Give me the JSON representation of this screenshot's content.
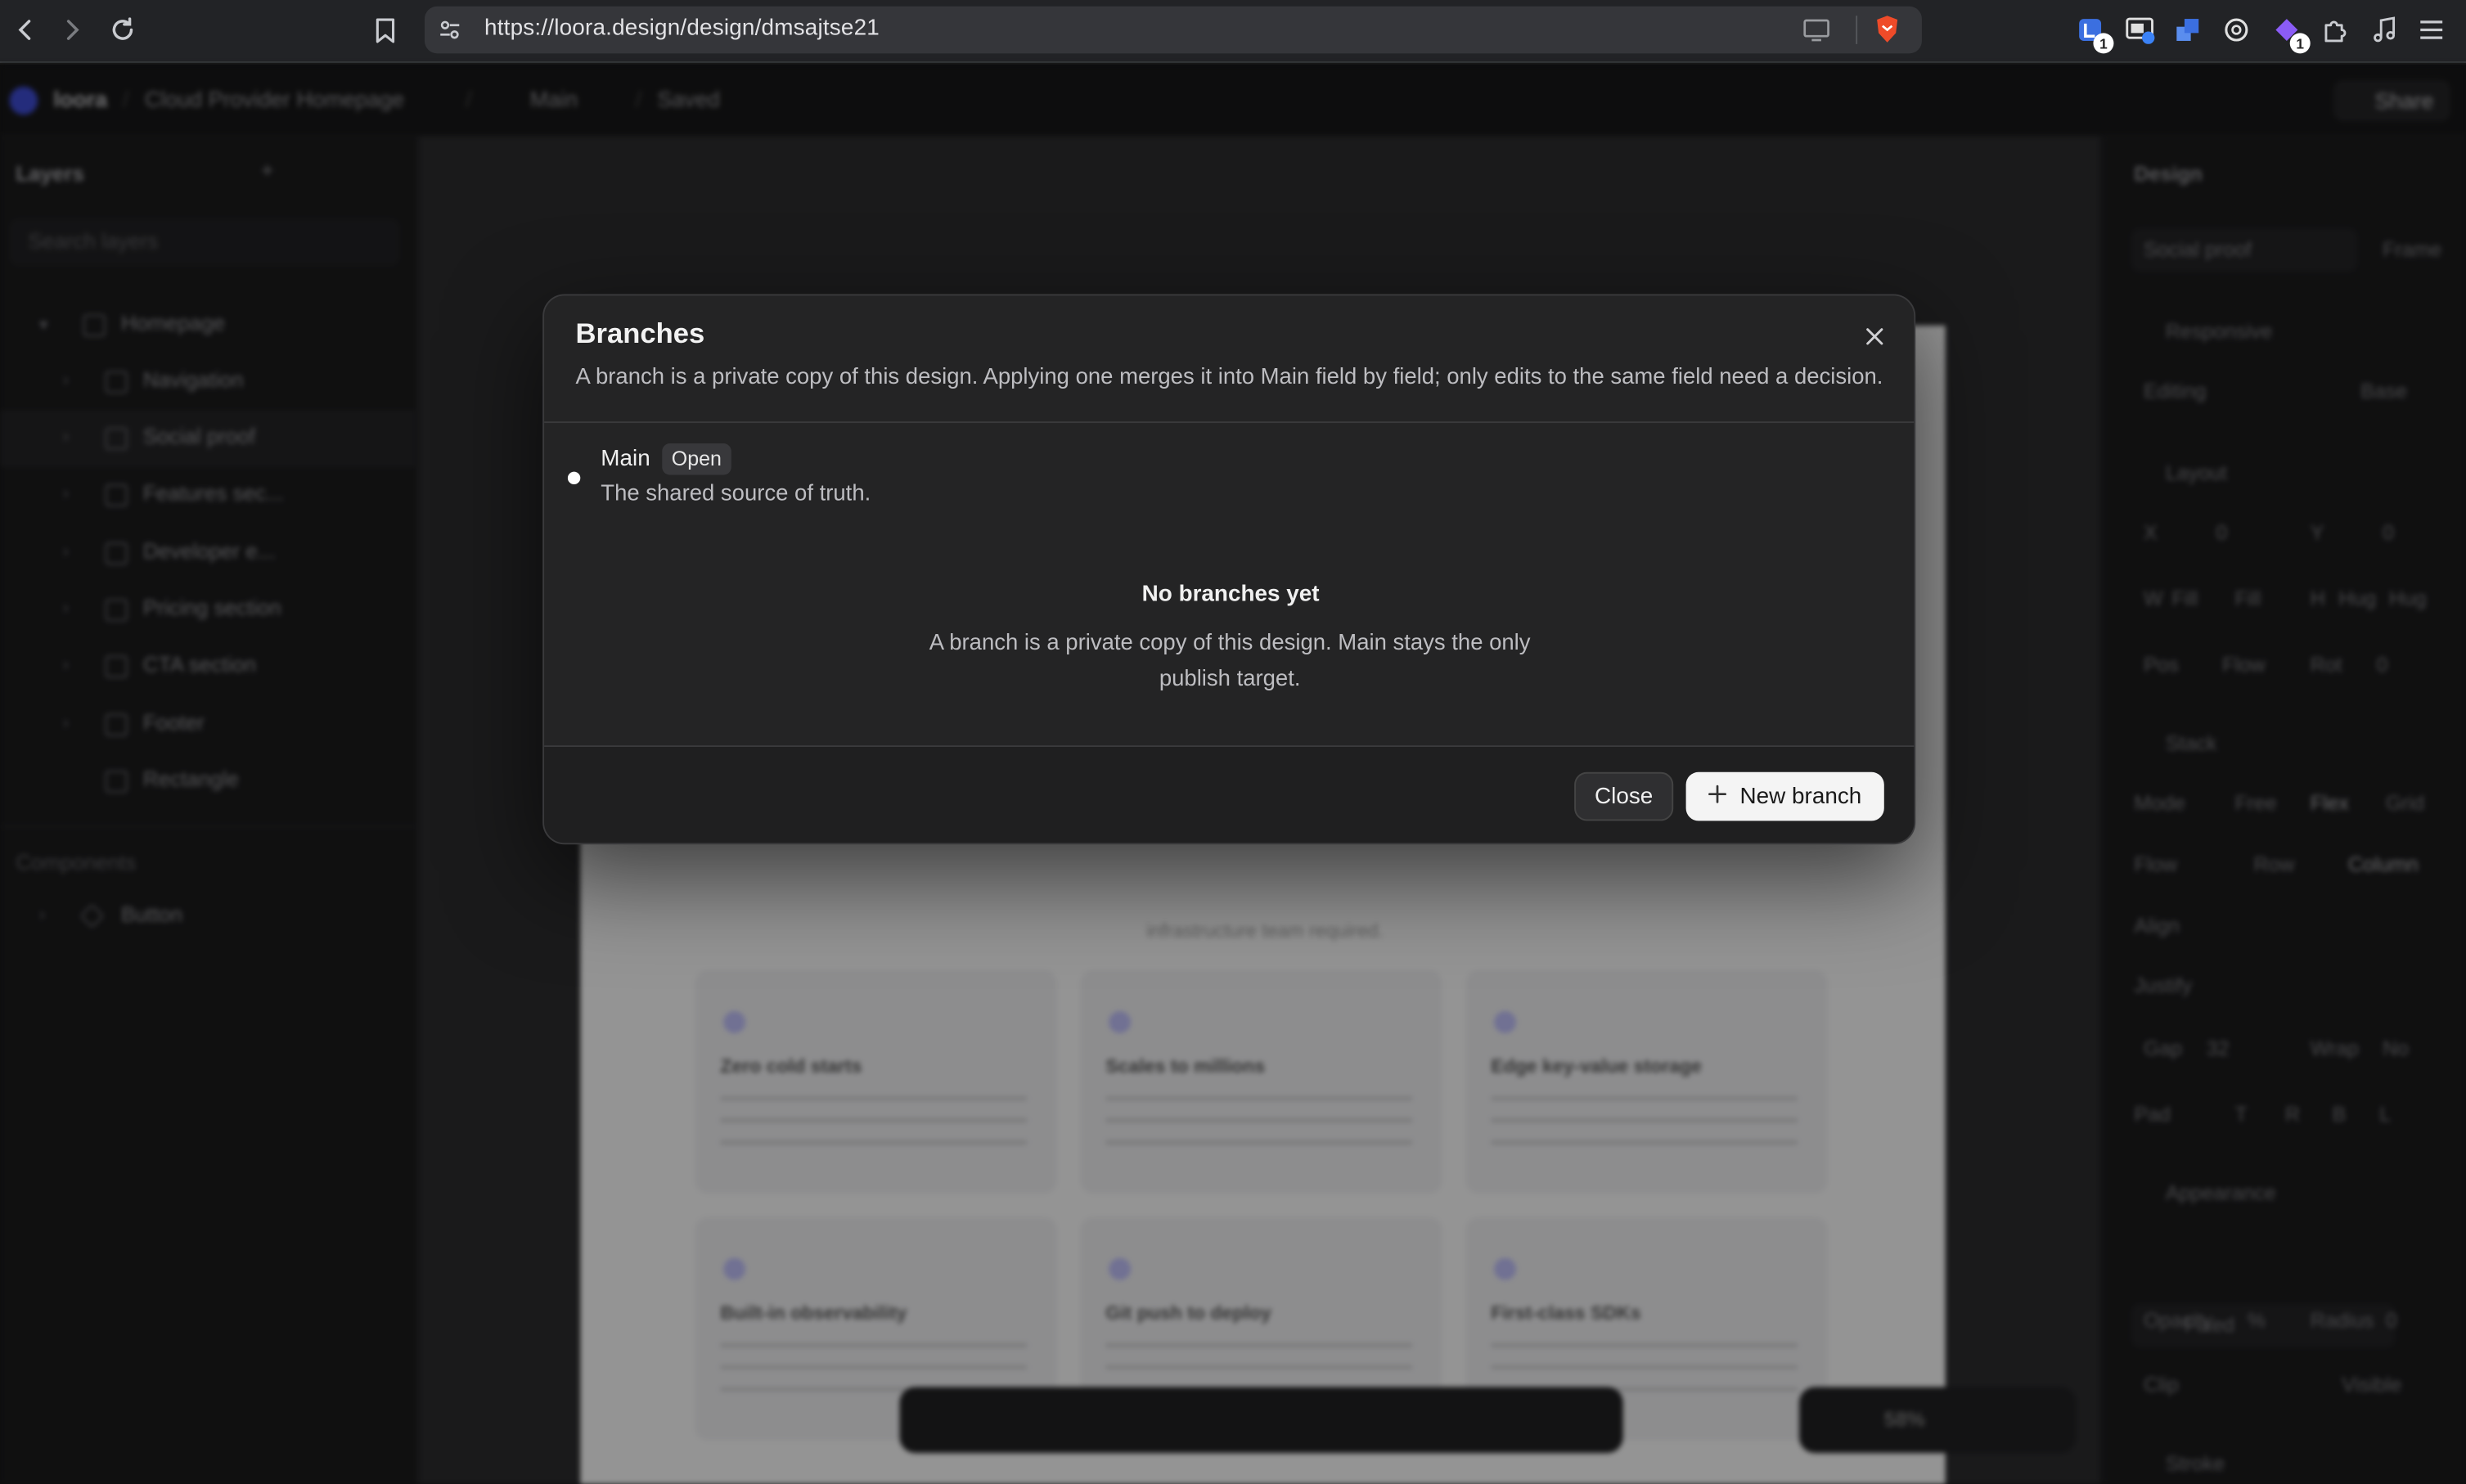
{
  "browser": {
    "url": "https://loora.design/design/dmsajtse21",
    "extension_badges": [
      "1",
      "1"
    ]
  },
  "app": {
    "workspace": "loora",
    "project": "Cloud Provider Homepage",
    "branch": "Main",
    "save_status": "Saved",
    "share_label": "Share",
    "layers_title": "Layers",
    "layers_search_placeholder": "Search layers",
    "layers": [
      "Homepage",
      "Navigation",
      "Social proof",
      "Features sec...",
      "Developer e...",
      "Pricing section",
      "CTA section",
      "Footer",
      "Rectangle"
    ],
    "components_title": "Components",
    "components": [
      "Button"
    ],
    "canvas_subtitle": "infrastructure team required.",
    "cards": [
      {
        "title": "Zero cold starts"
      },
      {
        "title": "Scales to millions"
      },
      {
        "title": "Edge key-value storage"
      },
      {
        "title": "Built-in observability"
      },
      {
        "title": "Git push to deploy"
      },
      {
        "title": "First-class SDKs"
      }
    ],
    "zoom": "58%",
    "design": {
      "title": "Design",
      "frame_name": "Social proof",
      "frame_type": "Frame",
      "responsive": "Responsive",
      "editing": "Editing",
      "editing_value": "Base",
      "layout": "Layout",
      "x_label": "X",
      "x_value": "0",
      "y_label": "Y",
      "y_value": "0",
      "w_label": "W",
      "w_value": "Fill",
      "w_mode": "Fill",
      "h_label": "H",
      "h_value": "Hug",
      "h_mode": "Hug",
      "pos_label": "Pos",
      "pos_value": "Flow",
      "rot_label": "Rot",
      "rot_value": "0",
      "stack": "Stack",
      "mode_label": "Mode",
      "modes": [
        "Free",
        "Flex",
        "Grid"
      ],
      "flow_label": "Flow",
      "flows": [
        "Row",
        "Column"
      ],
      "align_label": "Align",
      "justify_label": "Justify",
      "gap_label": "Gap",
      "gap_value": "32",
      "wrap_label": "Wrap",
      "wrap_value": "No",
      "pad_label": "Pad",
      "pads": [
        "T",
        "R",
        "B",
        "L"
      ],
      "appearance": "Appearance",
      "fill_value": "Fixed",
      "opacity_label": "Opacity",
      "opacity_unit": "%",
      "radius_label": "Radius",
      "radius_value": "0",
      "clip_label": "Clip",
      "clip_value": "Visible",
      "stroke": "Stroke"
    }
  },
  "dialog": {
    "title": "Branches",
    "subtitle": "A branch is a private copy of this design. Applying one merges it into Main field by field; only edits to the same field need a decision.",
    "main_branch": {
      "name": "Main",
      "status": "Open",
      "description": "The shared source of truth."
    },
    "empty_title": "No branches yet",
    "empty_description": "A branch is a private copy of this design. Main stays the only publish target.",
    "close_label": "Close",
    "new_branch_label": "New branch"
  }
}
